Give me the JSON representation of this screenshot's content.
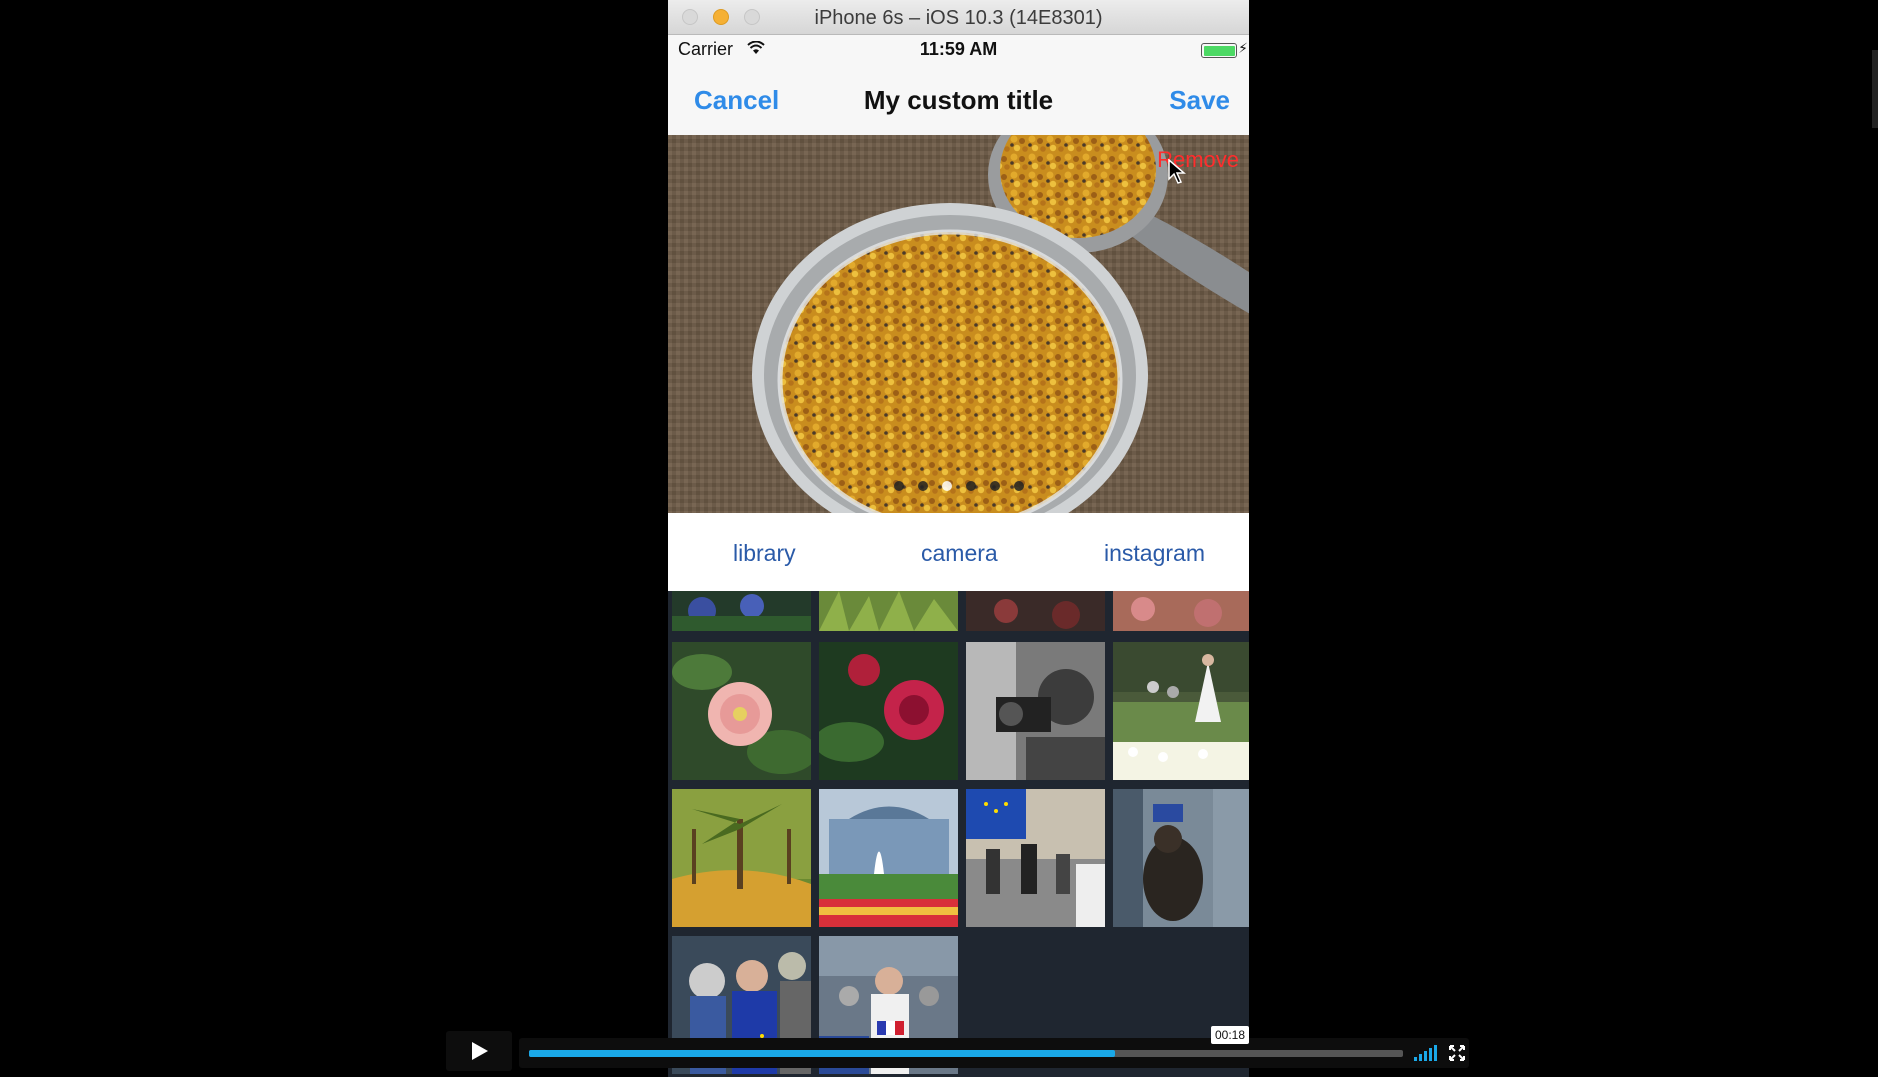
{
  "window": {
    "title": "iPhone 6s – iOS 10.3 (14E8301)"
  },
  "statusbar": {
    "carrier": "Carrier",
    "time": "11:59 AM"
  },
  "navbar": {
    "cancel_label": "Cancel",
    "title": "My custom title",
    "save_label": "Save"
  },
  "hero": {
    "remove_label": "Remove",
    "page_count": 6,
    "active_page": 2
  },
  "sources": {
    "library": "library",
    "camera": "camera",
    "instagram": "instagram"
  },
  "video": {
    "time": "00:18",
    "progress": 0.67
  },
  "colors": {
    "accent": "#2f8be8",
    "remove": "#ff2d2d",
    "source_text": "#2a5aa8",
    "progress": "#1aa8e8"
  },
  "grid": {
    "tiles": [
      "flowers-top",
      "plants-top",
      "roses-top",
      "garden-top",
      "pink-flower",
      "red-flower",
      "photographer-bw",
      "wedding-tulips",
      "palm-park",
      "fountain-building",
      "eu-flag-crowd",
      "dog-crowd",
      "eu-flag-people",
      "protest-sign"
    ]
  }
}
